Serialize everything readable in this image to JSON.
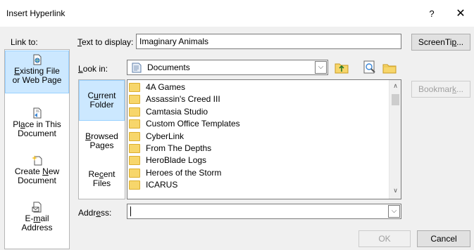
{
  "window": {
    "title": "Insert Hyperlink",
    "help_glyph": "?",
    "close_glyph": "✕"
  },
  "link_to": {
    "label": "Link to:",
    "items": [
      {
        "label": "Existing File or Web Page",
        "icon": "existing-file-icon",
        "selected": true
      },
      {
        "label": "Place in This Document",
        "icon": "place-in-document-icon",
        "selected": false
      },
      {
        "label": "Create New Document",
        "icon": "new-document-icon",
        "selected": false
      },
      {
        "label": "E-mail Address",
        "icon": "email-icon",
        "selected": false
      }
    ]
  },
  "text_to_display": {
    "label": "Text to display:",
    "value": "Imaginary Animals"
  },
  "screentip_button": "ScreenTip...",
  "look_in": {
    "label": "Look in:",
    "value": "Documents",
    "icon": "documents-folder-icon"
  },
  "toolbar_icons": [
    "up-folder-icon",
    "browse-web-icon",
    "browse-file-icon"
  ],
  "bookmark_button": "Bookmark...",
  "folder_nav": [
    {
      "label": "Current Folder",
      "selected": true
    },
    {
      "label": "Browsed Pages",
      "selected": false
    },
    {
      "label": "Recent Files",
      "selected": false
    }
  ],
  "files": [
    "4A Games",
    "Assassin's Creed III",
    "Camtasia Studio",
    "Custom Office Templates",
    "CyberLink",
    "From The Depths",
    "HeroBlade Logs",
    "Heroes of the Storm",
    "ICARUS"
  ],
  "address": {
    "label": "Address:",
    "value": ""
  },
  "ok_button": "OK",
  "cancel_button": "Cancel"
}
